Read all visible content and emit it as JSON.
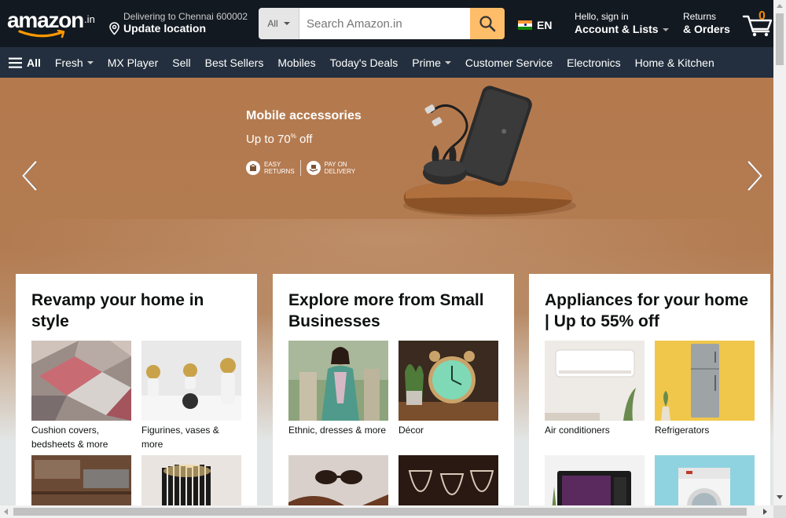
{
  "header": {
    "logo_text": "amazon",
    "logo_suffix": ".in",
    "deliver_line1": "Delivering to Chennai 600002",
    "deliver_line2": "Update location",
    "search_category": "All",
    "search_placeholder": "Search Amazon.in",
    "language": "EN",
    "account_line1": "Hello, sign in",
    "account_line2": "Account & Lists",
    "returns_line1": "Returns",
    "returns_line2": "& Orders",
    "cart_count": "0"
  },
  "nav": {
    "all_label": "All",
    "items": [
      {
        "label": "Fresh",
        "dropdown": true
      },
      {
        "label": "MX Player",
        "dropdown": false
      },
      {
        "label": "Sell",
        "dropdown": false
      },
      {
        "label": "Best Sellers",
        "dropdown": false
      },
      {
        "label": "Mobiles",
        "dropdown": false
      },
      {
        "label": "Today's Deals",
        "dropdown": false
      },
      {
        "label": "Prime",
        "dropdown": true
      },
      {
        "label": "Customer Service",
        "dropdown": false
      },
      {
        "label": "Electronics",
        "dropdown": false
      },
      {
        "label": "Home & Kitchen",
        "dropdown": false
      }
    ]
  },
  "hero": {
    "title": "Mobile accessories",
    "subtitle_prefix": "Up to 70",
    "subtitle_sup": "%",
    "subtitle_suffix": " off",
    "badge1_line1": "EASY",
    "badge1_line2": "RETURNS",
    "badge2_line1": "PAY ON",
    "badge2_line2": "DELIVERY"
  },
  "cards": [
    {
      "title": "Revamp your home in style",
      "tiles": [
        {
          "caption": "Cushion covers, bedsheets & more"
        },
        {
          "caption": "Figurines, vases & more"
        },
        {
          "caption": ""
        },
        {
          "caption": ""
        }
      ]
    },
    {
      "title": "Explore more from Small Businesses",
      "tiles": [
        {
          "caption": "Ethnic, dresses & more"
        },
        {
          "caption": "Décor"
        },
        {
          "caption": ""
        },
        {
          "caption": ""
        }
      ]
    },
    {
      "title": "Appliances for your home | Up to 55% off",
      "tiles": [
        {
          "caption": "Air conditioners"
        },
        {
          "caption": "Refrigerators"
        },
        {
          "caption": ""
        },
        {
          "caption": ""
        }
      ]
    }
  ],
  "colors": {
    "header_bg": "#131921",
    "nav_bg": "#232f3e",
    "search_button": "#febd69",
    "cart_count": "#f08804",
    "hero_bg": "#b47a4e"
  }
}
